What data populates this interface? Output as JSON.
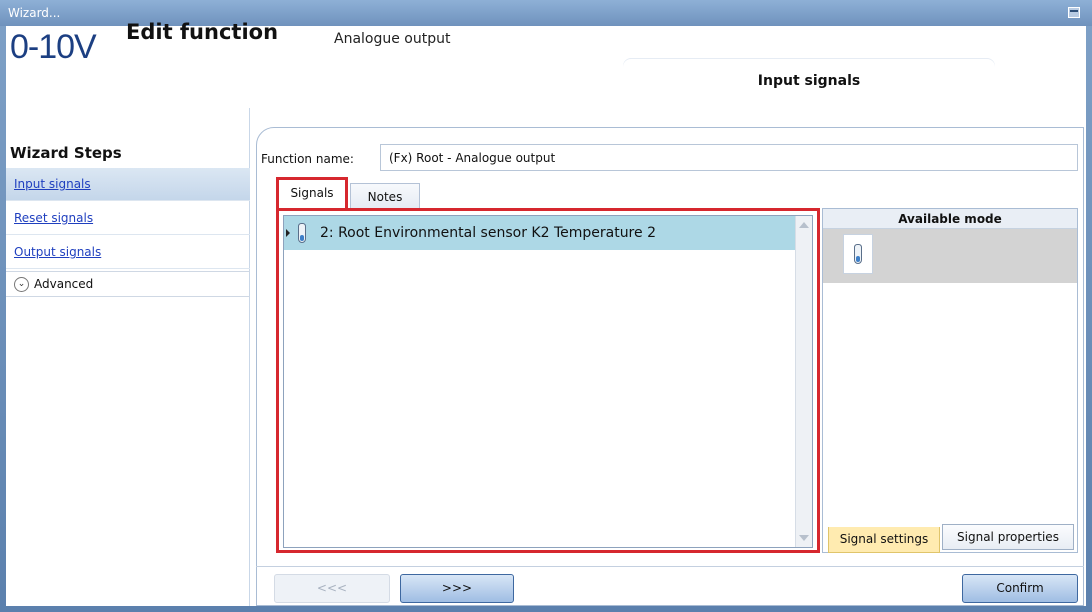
{
  "window": {
    "title": "Wizard..."
  },
  "header": {
    "logo_text": "0-10V",
    "title": "Edit function",
    "subtitle": "Analogue output",
    "current_step": "Input signals"
  },
  "sidebar": {
    "title": "Wizard Steps",
    "items": [
      {
        "label": "Input signals",
        "active": true
      },
      {
        "label": "Reset signals",
        "active": false
      },
      {
        "label": "Output signals",
        "active": false
      }
    ],
    "advanced_label": "Advanced"
  },
  "form": {
    "function_name_label": "Function name:",
    "function_name_value": "(Fx) Root - Analogue output"
  },
  "tabs": [
    {
      "label": "Signals",
      "selected": true
    },
    {
      "label": "Notes",
      "selected": false
    }
  ],
  "signals": [
    {
      "text": "2: Root Environmental sensor K2 Temperature 2",
      "icon": "thermometer-icon",
      "selected": true
    }
  ],
  "available_mode": {
    "header": "Available mode",
    "icon": "thermometer-icon"
  },
  "bottom_tabs": {
    "settings": "Signal settings",
    "properties": "Signal properties"
  },
  "buttons": {
    "back": "<<<",
    "next": ">>>",
    "confirm": "Confirm"
  },
  "colors": {
    "highlight_border": "#d6272e",
    "selected_row": "#add8e6",
    "link": "#1f3fbf",
    "logo": "#1c3f82"
  }
}
